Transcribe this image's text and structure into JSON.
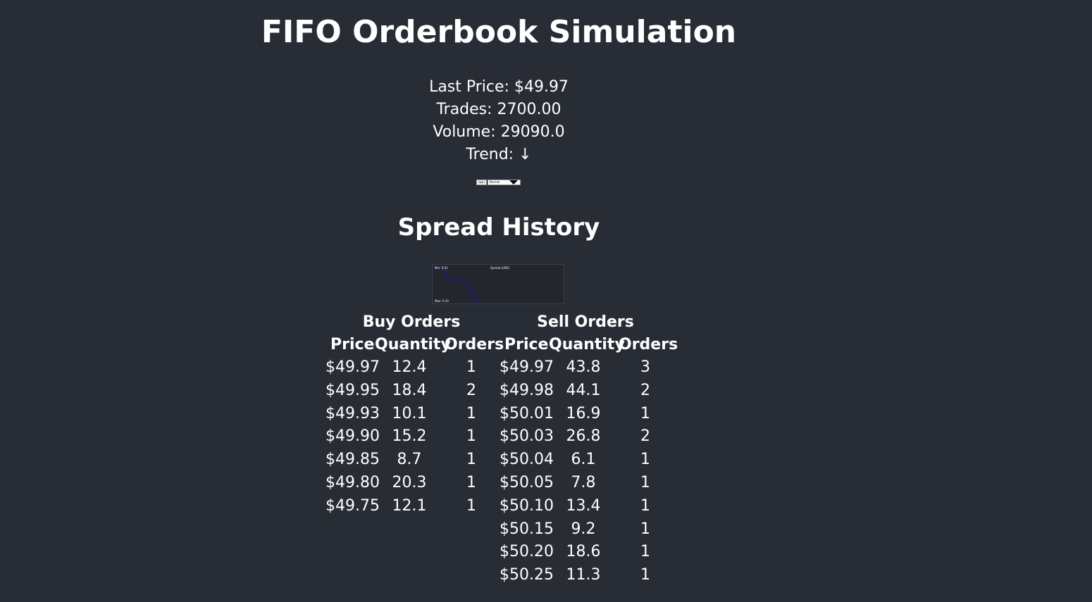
{
  "header": {
    "title": "FIFO Orderbook Simulation"
  },
  "stats": {
    "last_price": "Last Price: $49.97",
    "trades": "Trades: 2700.00",
    "volume": "Volume: 29090.0",
    "trend": "Trend: ↓"
  },
  "controls": {
    "start_label": "Start",
    "mode_value": "Normal"
  },
  "spread_history": {
    "title": "Spread History",
    "min_label": "Min: 0.01",
    "series_label": "Spread (USD)",
    "max_label": "Max: 0.10",
    "line_color": "#1a1aa6",
    "values": [
      0.01,
      0.025,
      0.04,
      0.04,
      0.04,
      0.055,
      0.08,
      0.1
    ]
  },
  "orderbook": {
    "buy": {
      "title": "Buy Orders",
      "headers": [
        "Price",
        "Quantity",
        "Orders"
      ],
      "rows": [
        [
          "$49.97",
          "12.4",
          "1"
        ],
        [
          "$49.95",
          "18.4",
          "2"
        ],
        [
          "$49.93",
          "10.1",
          "1"
        ],
        [
          "$49.90",
          "15.2",
          "1"
        ],
        [
          "$49.85",
          "8.7",
          "1"
        ],
        [
          "$49.80",
          "20.3",
          "1"
        ],
        [
          "$49.75",
          "12.1",
          "1"
        ]
      ]
    },
    "sell": {
      "title": "Sell Orders",
      "headers": [
        "Price",
        "Quantity",
        "Orders"
      ],
      "rows": [
        [
          "$49.97",
          "43.8",
          "3"
        ],
        [
          "$49.98",
          "44.1",
          "2"
        ],
        [
          "$50.01",
          "16.9",
          "1"
        ],
        [
          "$50.03",
          "26.8",
          "2"
        ],
        [
          "$50.04",
          "6.1",
          "1"
        ],
        [
          "$50.05",
          "7.8",
          "1"
        ],
        [
          "$50.10",
          "13.4",
          "1"
        ],
        [
          "$50.15",
          "9.2",
          "1"
        ],
        [
          "$50.20",
          "18.6",
          "1"
        ],
        [
          "$50.25",
          "11.3",
          "1"
        ]
      ]
    }
  }
}
